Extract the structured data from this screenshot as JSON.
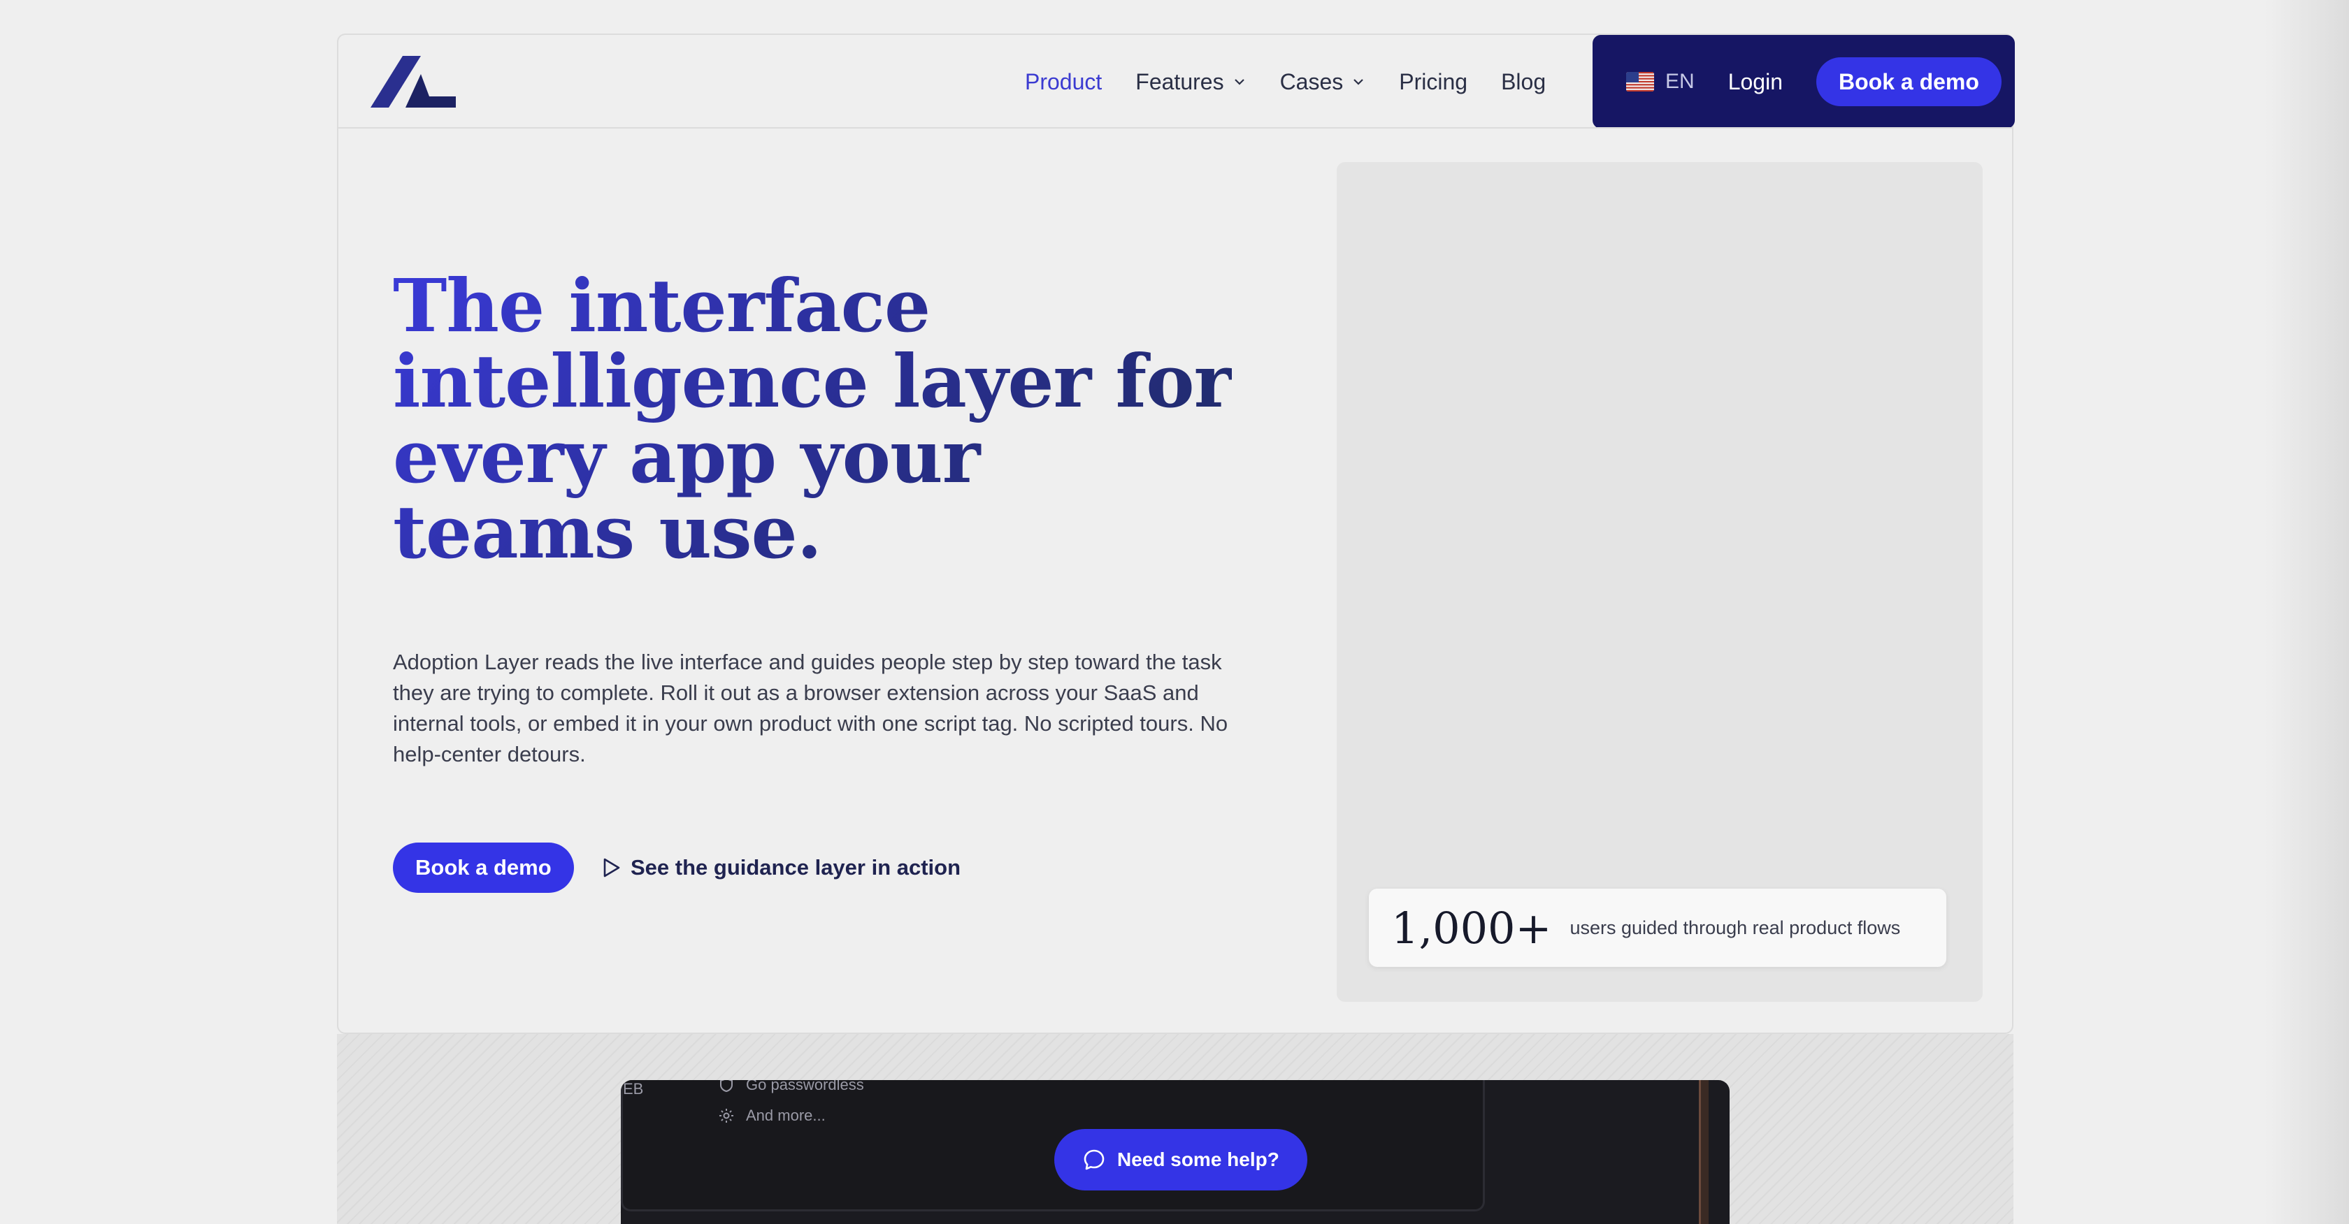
{
  "nav": {
    "items": [
      {
        "label": "Product",
        "active": true,
        "dropdown": false
      },
      {
        "label": "Features",
        "active": false,
        "dropdown": true
      },
      {
        "label": "Cases",
        "active": false,
        "dropdown": true
      },
      {
        "label": "Pricing",
        "active": false,
        "dropdown": false
      },
      {
        "label": "Blog",
        "active": false,
        "dropdown": false
      }
    ],
    "language": "EN",
    "login": "Login",
    "cta": "Book a demo"
  },
  "hero": {
    "headline": "The interface intelligence layer for every app your teams use.",
    "description": "Adoption Layer reads the live interface and guides people step by step toward the task they are trying to complete. Roll it out as a browser extension across your SaaS and internal tools, or embed it in your own product with one script tag. No scripted tours. No help-center detours.",
    "primary_cta": "Book a demo",
    "secondary_cta": "See the guidance layer in action"
  },
  "stat": {
    "value": "1,000+",
    "label": "users guided through real product flows"
  },
  "showcase": {
    "fragment": "EB",
    "menu_items": [
      {
        "icon": "shield-icon",
        "label": "Go passwordless"
      },
      {
        "icon": "gear-icon",
        "label": "And more..."
      }
    ]
  },
  "help_button": "Need some help?",
  "colors": {
    "accent": "#3434e6",
    "nav_dark": "#161664",
    "headline_start": "#3a3ad8",
    "headline_end": "#1e2a5e"
  }
}
